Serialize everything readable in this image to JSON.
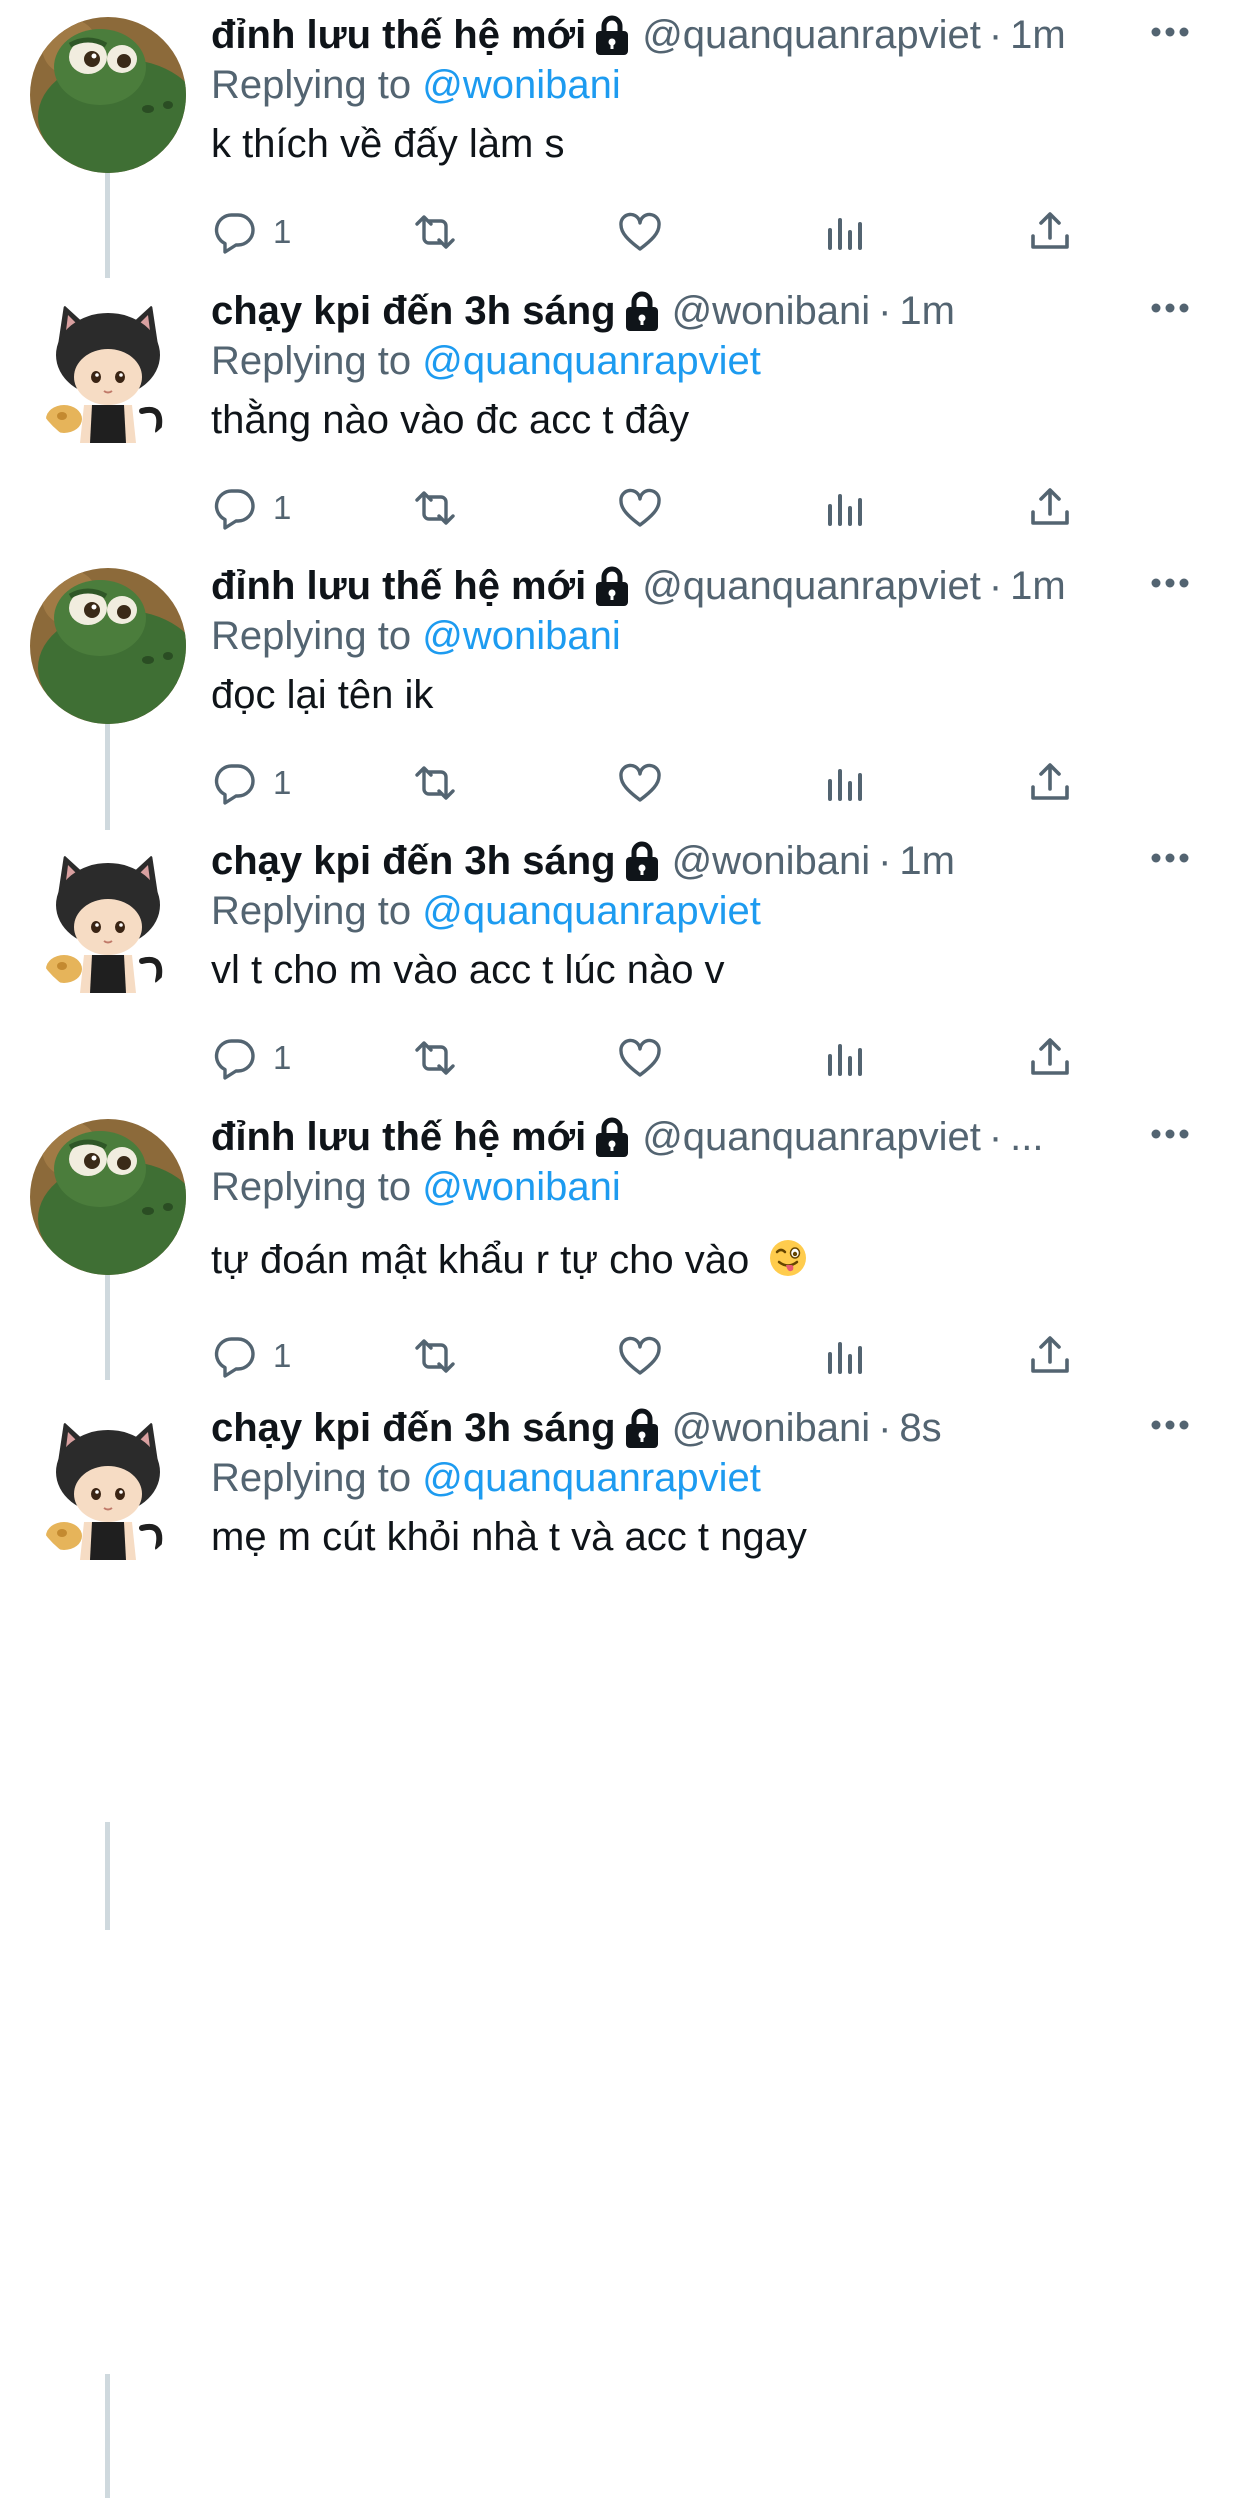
{
  "thread": [
    {
      "author": {
        "display_name": "đỉnh lưu thế hệ mới",
        "handle": "@quanquanrapviet",
        "avatar": "green-dinosaur-avatar"
      },
      "time": "1m",
      "replying_label": "Replying to",
      "replying_to": "@wonibani",
      "text": "k thích về đấy làm s",
      "emoji": "",
      "reply_count": "1"
    },
    {
      "author": {
        "display_name": "chạy kpi đến 3h sáng",
        "handle": "@wonibani",
        "avatar": "cat-hood-doll-avatar"
      },
      "time": "1m",
      "replying_label": "Replying to",
      "replying_to": "@quanquanrapviet",
      "text": "thằng nào vào đc acc t đây",
      "emoji": "",
      "reply_count": "1"
    },
    {
      "author": {
        "display_name": "đỉnh lưu thế hệ mới",
        "handle": "@quanquanrapviet",
        "avatar": "green-dinosaur-avatar"
      },
      "time": "1m",
      "replying_label": "Replying to",
      "replying_to": "@wonibani",
      "text": "đọc lại tên ik",
      "emoji": "",
      "reply_count": "1"
    },
    {
      "author": {
        "display_name": "chạy kpi đến 3h sáng",
        "handle": "@wonibani",
        "avatar": "cat-hood-doll-avatar"
      },
      "time": "1m",
      "replying_label": "Replying to",
      "replying_to": "@quanquanrapviet",
      "text": "vl t cho m vào acc t lúc nào v",
      "emoji": "",
      "reply_count": "1"
    },
    {
      "author": {
        "display_name": "đỉnh lưu thế hệ mới",
        "handle": "@quanquanrapviet",
        "avatar": "green-dinosaur-avatar"
      },
      "time": "...",
      "replying_label": "Replying to",
      "replying_to": "@wonibani",
      "text": "tự đoán mật khẩu r tự cho vào",
      "emoji": "winking-face-with-tongue",
      "reply_count": "1"
    },
    {
      "author": {
        "display_name": "chạy kpi đến 3h sáng",
        "handle": "@wonibani",
        "avatar": "cat-hood-doll-avatar"
      },
      "time": "8s",
      "replying_label": "Replying to",
      "replying_to": "@quanquanrapviet",
      "text": "mẹ m cút khỏi nhà t và acc t ngay",
      "emoji": "",
      "reply_count": ""
    }
  ],
  "colors": {
    "text": "#0f1419",
    "secondary": "#536471",
    "link": "#1d9bf0",
    "thread_line": "#cfd9de"
  }
}
